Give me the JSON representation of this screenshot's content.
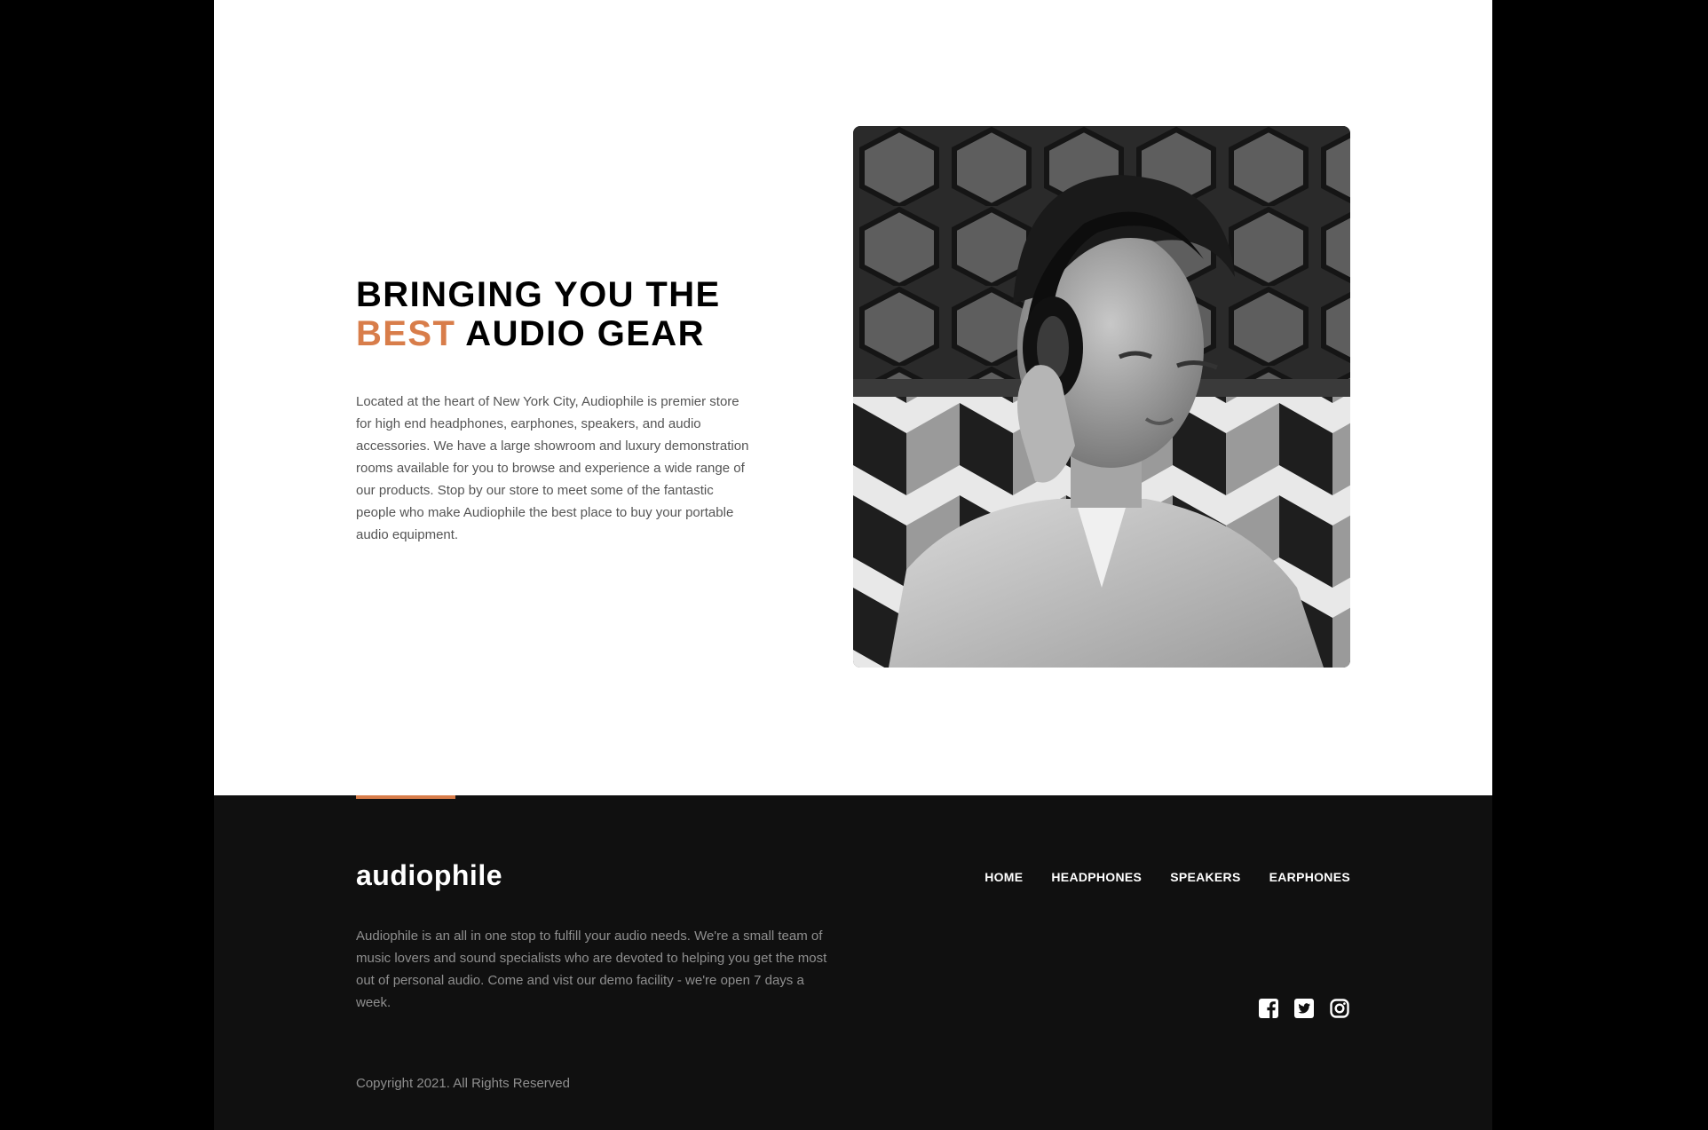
{
  "about": {
    "title_line1": "BRINGING YOU THE",
    "title_accent": "BEST",
    "title_rest": " AUDIO GEAR",
    "body": "Located at the heart of New York City, Audiophile is premier store for high end headphones, earphones, speakers, and audio accessories. We have a large showroom and luxury demonstration rooms available for you to browse and experience a wide range of our products. Stop by our store to meet some of the fantastic people who make Audiophile the best place to buy your portable audio equipment."
  },
  "footer": {
    "logo": "audiophile",
    "nav": [
      "HOME",
      "HEADPHONES",
      "SPEAKERS",
      "EARPHONES"
    ],
    "description": "Audiophile is an all in one stop to fulfill your audio needs. We're a small team of music lovers and sound specialists who are devoted to helping you get the most out of personal audio. Come and vist our demo facility - we're open 7 days a week.",
    "social": [
      "facebook-icon",
      "twitter-icon",
      "instagram-icon"
    ],
    "copyright": "Copyright 2021. All Rights Reserved"
  },
  "colors": {
    "accent": "#d87d4a",
    "footer_bg": "#101010",
    "page_bg": "#ffffff",
    "outer_bg": "#000000"
  }
}
